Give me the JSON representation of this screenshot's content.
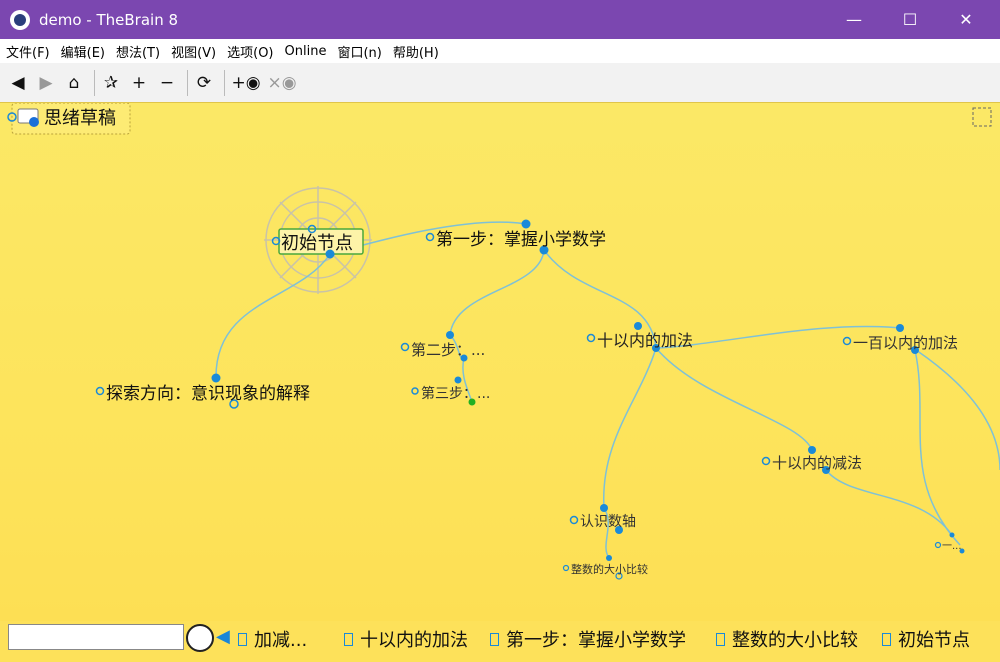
{
  "window": {
    "title": "demo - TheBrain 8"
  },
  "menu": [
    "文件(F)",
    "编辑(E)",
    "想法(T)",
    "视图(V)",
    "选项(O)",
    "Online",
    "窗口(n)",
    "帮助(H)"
  ],
  "toolbar": {
    "buttons": [
      "back",
      "forward",
      "home",
      "layout",
      "zoom-in",
      "zoom-out",
      "refresh",
      "add-link",
      "remove-link"
    ]
  },
  "canvas": {
    "pinned_label": "思绪草稿",
    "thoughts": {
      "active": "初始节点",
      "step1": "第一步：掌握小学数学",
      "explore": "探索方向：意识现象的解释",
      "step2": "第二步：...",
      "step3": "第三步：...",
      "add10": "十以内的加法",
      "add100": "一百以内的加法",
      "sub10": "十以内的减法",
      "numberline": "认识数轴",
      "compare": "整数的大小比较",
      "ellipsis": "一..."
    }
  },
  "search": {
    "value": ""
  },
  "history": [
    "加减...",
    "十以内的加法",
    "第一步：掌握小学数学",
    "整数的大小比较",
    "初始节点"
  ],
  "colors": {
    "titlebar": "#7b47b0",
    "canvas": "#fde45c",
    "link": "#7fc1d6",
    "node": "#1a8ad8"
  }
}
